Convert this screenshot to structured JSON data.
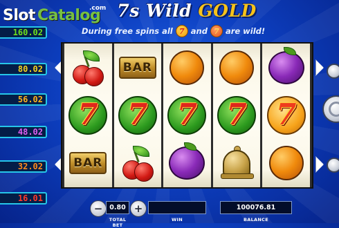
{
  "watermark": {
    "slot": "Slot",
    "catalog": "Catalog",
    "com": ".com"
  },
  "title": {
    "part1": "7s Wild",
    "part2": "GOLD"
  },
  "subtitle": {
    "before": "During free spins all",
    "middle": "and",
    "after": "are wild!",
    "icon_symbol": "7"
  },
  "paylines": [
    {
      "value": "160.02",
      "color": "#6ee01c"
    },
    {
      "value": "80.02",
      "color": "#f4d21e"
    },
    {
      "value": "56.02",
      "color": "#ffb21c"
    },
    {
      "value": "48.02",
      "color": "#e05ef0"
    },
    {
      "value": "32.02",
      "color": "#ff8a1c"
    },
    {
      "value": "16.01",
      "color": "#ff3a2a"
    }
  ],
  "reels": [
    [
      "cherry",
      "seven-green",
      "bar"
    ],
    [
      "bar",
      "seven-green",
      "cherry"
    ],
    [
      "orange",
      "seven-green",
      "plum"
    ],
    [
      "orange",
      "seven-green",
      "bell"
    ],
    [
      "plum",
      "seven-orange",
      "orange"
    ]
  ],
  "symbol_text": {
    "bar": "BAR",
    "seven": "7"
  },
  "controls": {
    "minus": "−",
    "plus": "+",
    "total_bet_value": "0.80",
    "total_bet_label": "TOTAL BET",
    "win_value": "",
    "win_label": "WIN",
    "balance_value": "100076.81",
    "balance_label": "BALANCE"
  },
  "icons": {
    "spin": "spin-button-icon",
    "autoplay": "autoplay-button-icon",
    "menu": "menu-button-icon"
  }
}
